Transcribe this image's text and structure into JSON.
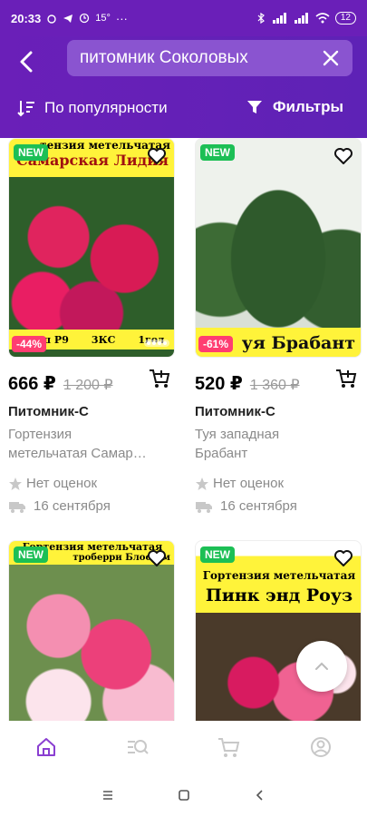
{
  "status_bar": {
    "time": "20:33",
    "temp": "15°",
    "more": "···",
    "battery": "12"
  },
  "search": {
    "value": "питомник Соколовых"
  },
  "toolbar": {
    "sort_label": "По популярности",
    "filter_label": "Фильтры"
  },
  "colors": {
    "brand": "#6a1fb8",
    "new_badge": "#1cbf55",
    "discount": "#ff3d71",
    "nav_active": "#8a3fd1"
  },
  "products": [
    {
      "badge": "NEW",
      "image_text_top": "тензия метельчатая",
      "image_text_main": "Самарская Лидия",
      "image_text_bottom_1": "горш Р9",
      "image_text_bottom_2": "3КС",
      "image_text_bottom_3": "1год",
      "discount": "-44%",
      "price": "666 ₽",
      "old_price": "1 200 ₽",
      "seller": "Питомник-С",
      "name_line1": "Гортензия",
      "name_line2": "метельчатая Самар…",
      "rating": "Нет оценок",
      "delivery": "16 сентября"
    },
    {
      "badge": "NEW",
      "image_text_main": "уя Брабант",
      "discount": "-61%",
      "price": "520 ₽",
      "old_price": "1 360 ₽",
      "seller": "Питомник-С",
      "name_line1": "Туя западная",
      "name_line2": "Брабант",
      "rating": "Нет оценок",
      "delivery": "16 сентября"
    },
    {
      "badge": "NEW",
      "image_text_top": "Гортензия метельчатая",
      "image_text_main": "троберри Блоссом"
    },
    {
      "badge": "NEW",
      "image_text_top": "Гортензия метельчатая",
      "image_text_main": "Пинк энд Роуз"
    }
  ],
  "icons": {
    "back": "back-arrow-icon",
    "clear": "close-icon",
    "sort": "sort-icon",
    "filter": "filter-funnel-icon",
    "favorite": "heart-icon",
    "cart": "add-to-cart-icon",
    "star": "star-icon",
    "truck": "truck-icon",
    "scroll_top": "chevron-up-icon"
  }
}
